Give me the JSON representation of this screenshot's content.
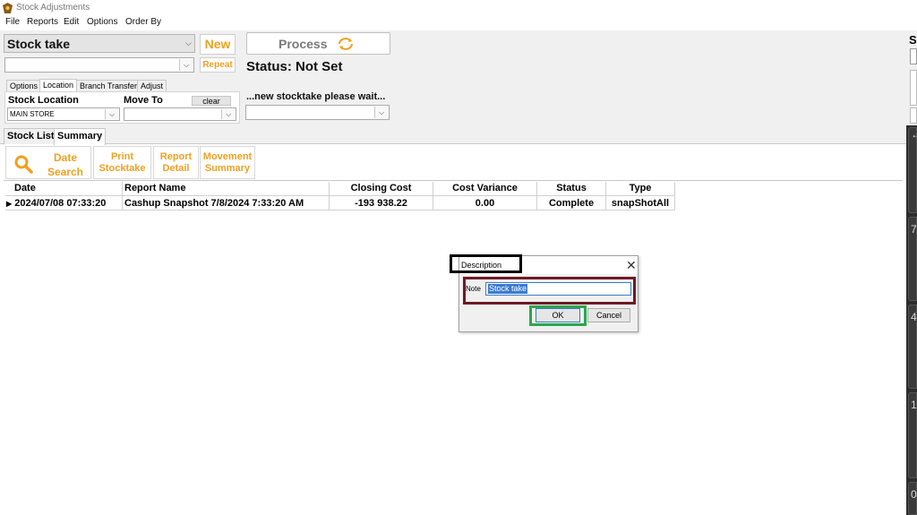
{
  "window": {
    "title": "Stock Adjustments"
  },
  "menu": [
    "File",
    "Reports",
    "Edit",
    "Options",
    "Order By"
  ],
  "top": {
    "mode_combo": "Stock take",
    "new_label": "New",
    "repeat_label": "Repeat",
    "process_label": "Process",
    "status_text": "Status: Not Set",
    "wait_text": "...new stocktake please wait...",
    "right_clipped_letter": "S"
  },
  "subtabs": [
    "Options",
    "Location",
    "Branch Transfer",
    "Adjust"
  ],
  "location": {
    "stock_location_label": "Stock Location",
    "move_to_label": "Move To",
    "clear_label": "clear",
    "stock_location_value": "MAIN STORE"
  },
  "main_tabs": [
    "Stock List",
    "Summary"
  ],
  "toolbar": {
    "date_search": [
      "Date",
      "Search"
    ],
    "print_stocktake": [
      "Print",
      "Stocktake"
    ],
    "report_detail": [
      "Report",
      "Detail"
    ],
    "movement_summary": [
      "Movement",
      "Summary"
    ]
  },
  "grid": {
    "columns": [
      "Date",
      "Report Name",
      "Closing Cost",
      "Cost Variance",
      "Status",
      "Type"
    ],
    "rows": [
      [
        "2024/07/08 07:33:20",
        "Cashup Snapshot 7/8/2024 7:33:20 AM",
        "-193 938.22",
        "0.00",
        "Complete",
        "snapShotAll"
      ]
    ]
  },
  "dialog": {
    "title": "Description",
    "note_label": "Note",
    "note_value": "Stock take",
    "ok_label": "OK",
    "cancel_label": "Cancel"
  },
  "right_panel_digits": [
    "7",
    "4",
    "1",
    "0"
  ],
  "colors": {
    "accent": "#f0a020",
    "highlight_title": "#000000",
    "highlight_note": "#6e1a26",
    "highlight_ok": "#2aa84a",
    "selection": "#3b7bd0"
  }
}
